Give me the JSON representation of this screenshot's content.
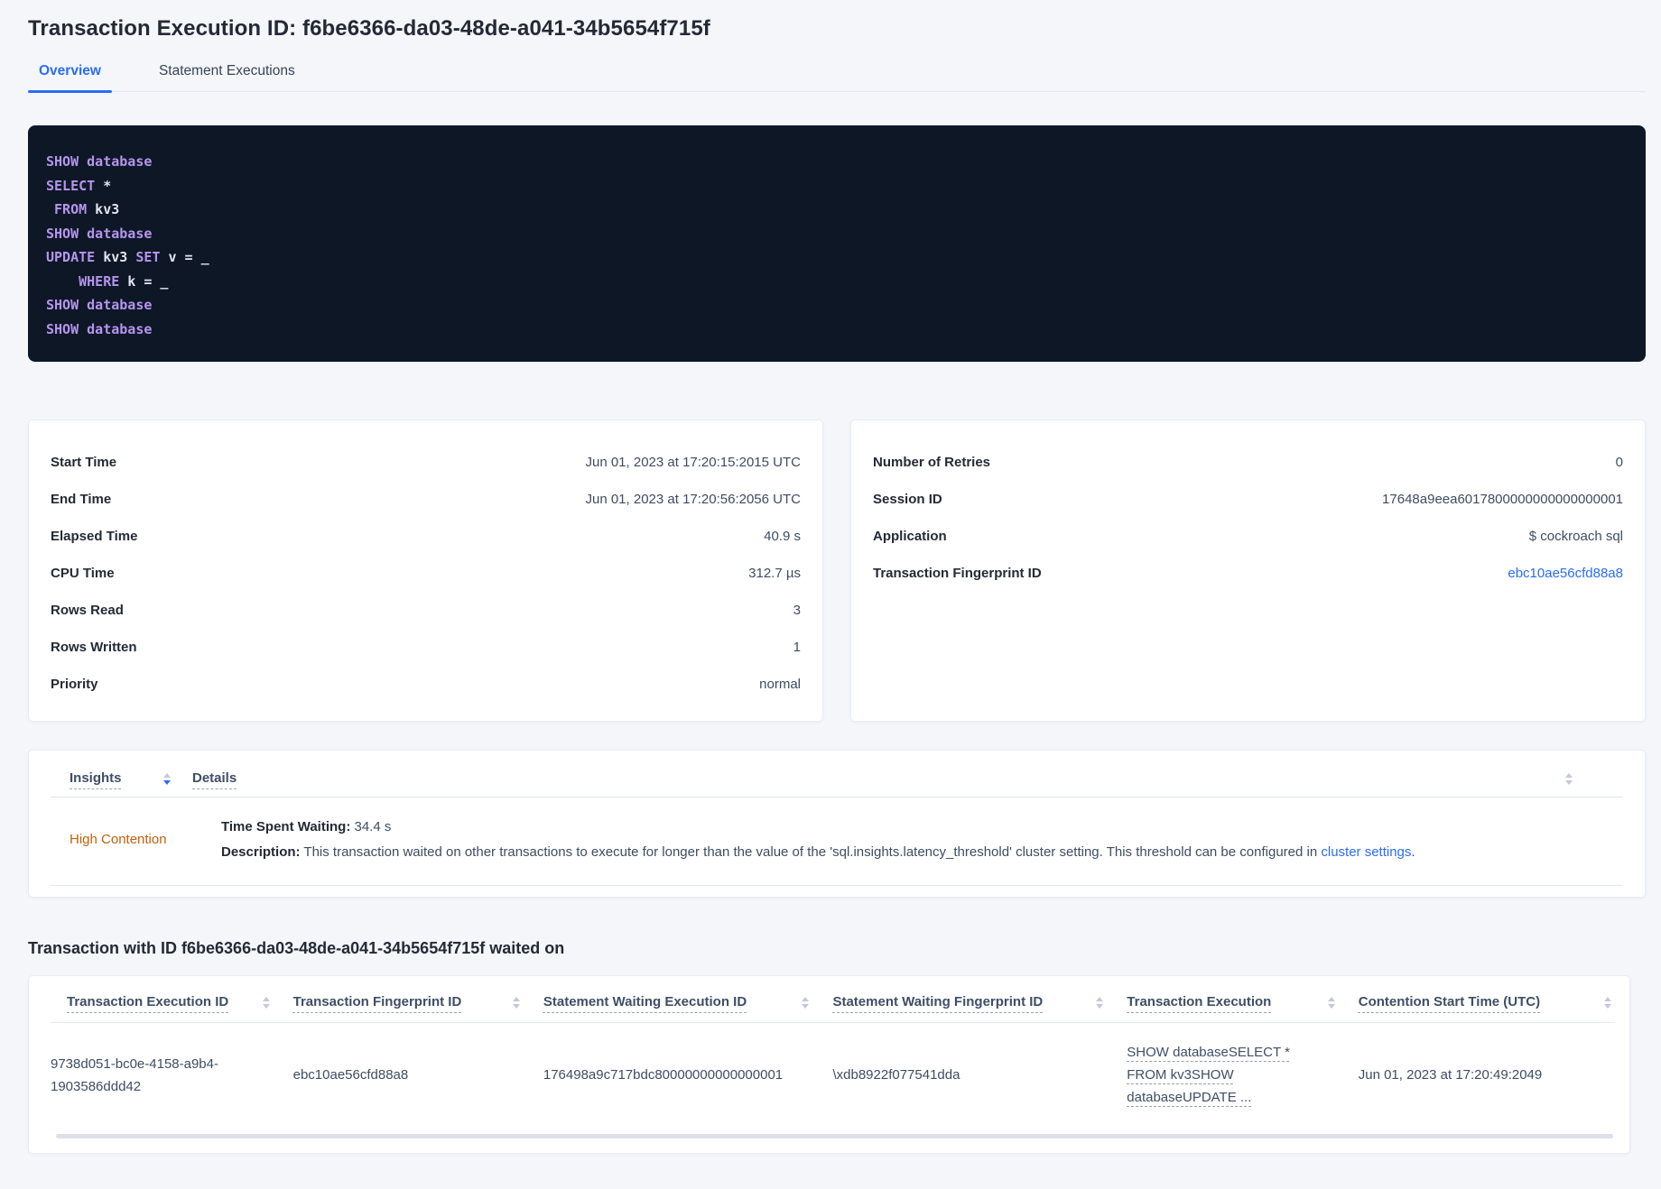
{
  "page": {
    "title": "Transaction Execution ID: f6be6366-da03-48de-a041-34b5654f715f"
  },
  "tabs": {
    "overview": "Overview",
    "statement_executions": "Statement Executions"
  },
  "sql_box": {
    "lines": [
      [
        {
          "t": "SHOW database",
          "c": "kw"
        }
      ],
      [
        {
          "t": "SELECT",
          "c": "kw"
        },
        {
          "t": " *",
          "c": "pl"
        }
      ],
      [
        {
          "t": " ",
          "c": "pl"
        },
        {
          "t": "FROM",
          "c": "kw"
        },
        {
          "t": " kv3",
          "c": "pl"
        }
      ],
      [
        {
          "t": "SHOW database",
          "c": "kw"
        }
      ],
      [
        {
          "t": "UPDATE",
          "c": "kw"
        },
        {
          "t": " kv3 ",
          "c": "pl"
        },
        {
          "t": "SET",
          "c": "kw"
        },
        {
          "t": " v = _",
          "c": "pl"
        }
      ],
      [
        {
          "t": "    ",
          "c": "pl"
        },
        {
          "t": "WHERE",
          "c": "kw"
        },
        {
          "t": " k = _",
          "c": "pl"
        }
      ],
      [
        {
          "t": "SHOW database",
          "c": "kw"
        }
      ],
      [
        {
          "t": "SHOW database",
          "c": "kw"
        }
      ]
    ]
  },
  "details_cards": {
    "left": {
      "rows": [
        {
          "label": "Start Time",
          "value": "Jun 01, 2023 at 17:20:15:2015 UTC"
        },
        {
          "label": "End Time",
          "value": "Jun 01, 2023 at 17:20:56:2056 UTC"
        },
        {
          "label": "Elapsed Time",
          "value": "40.9 s"
        },
        {
          "label": "CPU Time",
          "value": "312.7 µs"
        },
        {
          "label": "Rows Read",
          "value": "3"
        },
        {
          "label": "Rows Written",
          "value": "1"
        },
        {
          "label": "Priority",
          "value": "normal"
        }
      ]
    },
    "right": {
      "rows": [
        {
          "label": "Number of Retries",
          "value": "0"
        },
        {
          "label": "Session ID",
          "value": "17648a9eea6017800000000000000001"
        },
        {
          "label": "Application",
          "value": "$ cockroach sql"
        }
      ],
      "fingerprint_label": "Transaction Fingerprint ID",
      "fingerprint_value": "ebc10ae56cfd88a8"
    }
  },
  "insights_table": {
    "col_insights": "Insights",
    "col_details": "Details",
    "row": {
      "insight": "High Contention",
      "waiting_label": "Time Spent Waiting:",
      "waiting_value": " 34.4 s",
      "description_label": "Description:",
      "description_text": " This transaction waited on other transactions to execute for longer than the value of the 'sql.insights.latency_threshold' cluster setting. This threshold can be configured in ",
      "description_link": "cluster settings",
      "description_suffix": "."
    }
  },
  "waited_on": {
    "heading": "Transaction with ID f6be6366-da03-48de-a041-34b5654f715f waited on",
    "columns": [
      "Transaction Execution ID",
      "Transaction Fingerprint ID",
      "Statement Waiting Execution ID",
      "Statement Waiting Fingerprint ID",
      "Transaction Execution",
      "Contention Start Time (UTC)"
    ],
    "row": {
      "transaction_execution_id": "9738d051-bc0e-4158-a9b4-1903586ddd42",
      "transaction_fingerprint_id": "ebc10ae56cfd88a8",
      "statement_waiting_execution_id": "176498a9c717bdc80000000000000001",
      "statement_waiting_fingerprint_id": "\\xdb8922f077541dda",
      "transaction_execution": "SHOW databaseSELECT * FROM kv3SHOW databaseUPDATE ...",
      "contention_start_time": "Jun 01, 2023 at 17:20:49:2049"
    }
  },
  "colors": {
    "accent_blue": "#2a6df4",
    "insight_orange": "#c0610a",
    "code_background": "#0e1726",
    "code_keyword": "#b695ee",
    "page_background": "#f4f6fa"
  }
}
